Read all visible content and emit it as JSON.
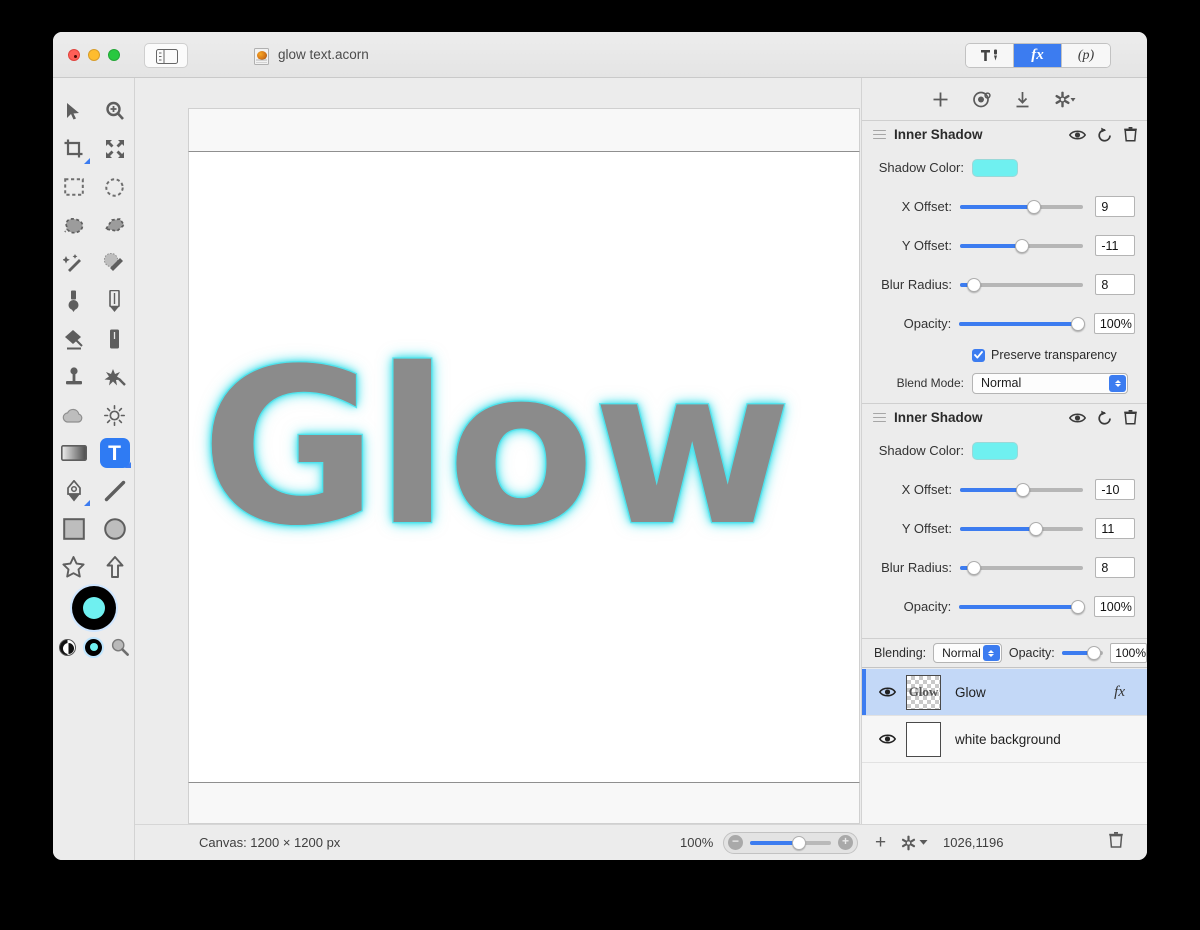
{
  "window": {
    "title": "glow text.acorn",
    "traffic_lights": [
      "close",
      "minimize",
      "zoom"
    ]
  },
  "inspector_tabs": [
    {
      "id": "tools",
      "icon": "hammer-icon",
      "label": "",
      "active": false
    },
    {
      "id": "fx",
      "icon": "fx-icon",
      "label": "fx",
      "active": true
    },
    {
      "id": "presets",
      "icon": "presets-icon",
      "label": "(p)",
      "active": false
    }
  ],
  "fx_toolbar": [
    {
      "name": "add-effect-icon",
      "glyph": "+"
    },
    {
      "name": "effect-palette-icon",
      "glyph": "◎"
    },
    {
      "name": "import-effect-icon",
      "glyph": "↓"
    },
    {
      "name": "effect-settings-gear-icon",
      "glyph": "✿"
    }
  ],
  "effects": [
    {
      "title": "Inner Shadow",
      "shadow_color_label": "Shadow Color:",
      "shadow_color": "#6ff0f0",
      "sliders": [
        {
          "label": "X Offset:",
          "value": "9",
          "fill_pct": 60
        },
        {
          "label": "Y Offset:",
          "value": "-11",
          "fill_pct": 50
        },
        {
          "label": "Blur Radius:",
          "value": "8",
          "fill_pct": 11
        },
        {
          "label": "Opacity:",
          "value": "100%",
          "fill_pct": 100
        }
      ],
      "preserve_transparency_label": "Preserve transparency",
      "preserve_transparency": true,
      "blend_mode_label": "Blend Mode:",
      "blend_mode": "Normal",
      "header_icons": [
        "eye-icon",
        "reset-icon",
        "trash-icon"
      ]
    },
    {
      "title": "Inner Shadow",
      "shadow_color_label": "Shadow Color:",
      "shadow_color": "#6ff0f0",
      "sliders": [
        {
          "label": "X Offset:",
          "value": "-10",
          "fill_pct": 51
        },
        {
          "label": "Y Offset:",
          "value": "11",
          "fill_pct": 62
        },
        {
          "label": "Blur Radius:",
          "value": "8",
          "fill_pct": 11
        },
        {
          "label": "Opacity:",
          "value": "100%",
          "fill_pct": 100
        }
      ],
      "header_icons": [
        "eye-icon",
        "reset-icon",
        "trash-icon"
      ]
    }
  ],
  "layers_panel": {
    "blending_label": "Blending:",
    "blending_mode": "Normal",
    "opacity_label": "Opacity:",
    "opacity_value": "100%",
    "opacity_fill_pct": 78,
    "layers": [
      {
        "name": "Glow",
        "thumb_text": "Glow",
        "visible": true,
        "has_fx": true,
        "fx_badge": "fx",
        "selected": true,
        "transparent": true
      },
      {
        "name": "white background",
        "thumb_text": "",
        "visible": true,
        "has_fx": false,
        "fx_badge": "",
        "selected": false,
        "transparent": false
      }
    ]
  },
  "canvas": {
    "text": "Glow",
    "text_color": "#8b8b8b",
    "glow_color": "#50e4ee",
    "background": "#ffffff"
  },
  "statusbar": {
    "canvas_label": "Canvas: 1200 × 1200 px",
    "zoom_percent": "100%",
    "coordinates": "1026,1196",
    "zoom_out_icon": "minus-icon",
    "zoom_in_icon": "plus-icon",
    "add_layer_icon": "plus-icon",
    "layer_settings_icon": "gear-icon",
    "delete_layer_icon": "trash-icon"
  },
  "tools": [
    {
      "name": "move-tool",
      "glyph": "arrow"
    },
    {
      "name": "zoom-tool",
      "glyph": "zoom"
    },
    {
      "name": "crop-tool",
      "glyph": "crop"
    },
    {
      "name": "transform-tool",
      "glyph": "transform"
    },
    {
      "name": "rect-select-tool",
      "glyph": "rectselect"
    },
    {
      "name": "ellipse-select-tool",
      "glyph": "ellipseselect"
    },
    {
      "name": "lasso-tool",
      "glyph": "lasso"
    },
    {
      "name": "polygon-lasso-tool",
      "glyph": "polylasso"
    },
    {
      "name": "magic-wand-tool",
      "glyph": "wand"
    },
    {
      "name": "instant-alpha-tool",
      "glyph": "alpha"
    },
    {
      "name": "brush-tool",
      "glyph": "brush"
    },
    {
      "name": "pencil-tool",
      "glyph": "pencil"
    },
    {
      "name": "paint-bucket-tool",
      "glyph": "bucket"
    },
    {
      "name": "eraser-tool",
      "glyph": "eraser"
    },
    {
      "name": "clone-stamp-tool",
      "glyph": "stamp"
    },
    {
      "name": "smudge-tool",
      "glyph": "smudge"
    },
    {
      "name": "blur-tool",
      "glyph": "cloud"
    },
    {
      "name": "dodge-burn-tool",
      "glyph": "sun"
    },
    {
      "name": "gradient-tool",
      "glyph": "gradient"
    },
    {
      "name": "text-tool",
      "glyph": "T",
      "selected": true
    },
    {
      "name": "bezier-pen-tool",
      "glyph": "pen"
    },
    {
      "name": "line-tool",
      "glyph": "line"
    },
    {
      "name": "rectangle-shape-tool",
      "glyph": "square"
    },
    {
      "name": "ellipse-shape-tool",
      "glyph": "circle"
    },
    {
      "name": "star-shape-tool",
      "glyph": "star"
    },
    {
      "name": "arrow-shape-tool",
      "glyph": "uparrow"
    }
  ],
  "color_well": {
    "foreground": "#6ff0f0",
    "ring": "#000000",
    "swap_icon": "bw-swap-icon",
    "picker_icon": "color-picker-icon",
    "loupe_icon": "magnifier-icon"
  }
}
